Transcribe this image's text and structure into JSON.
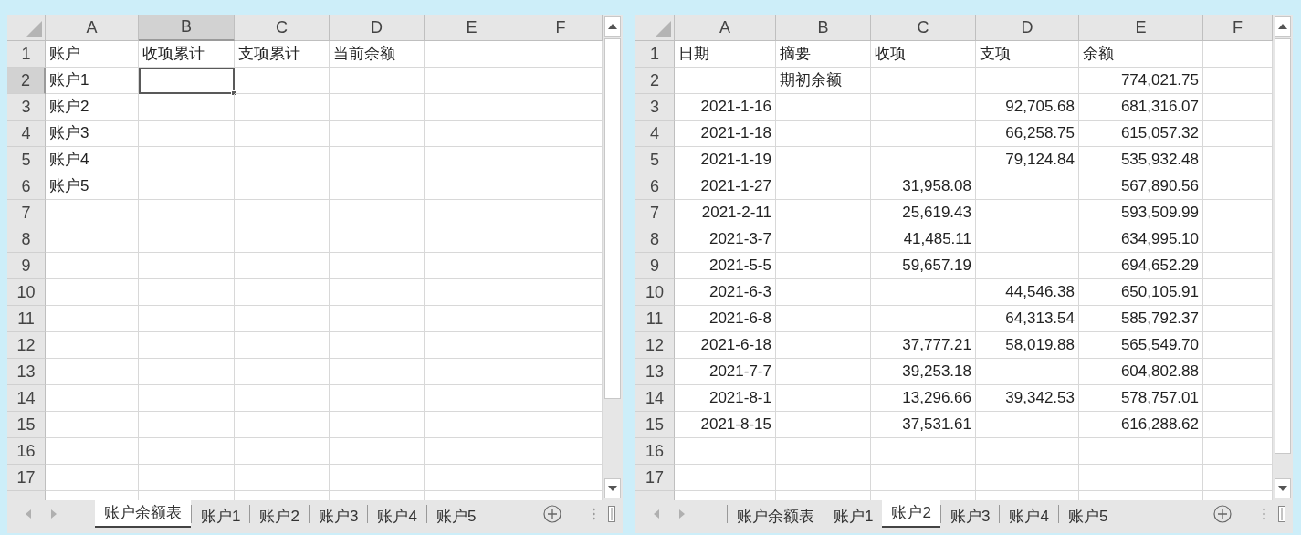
{
  "windows": [
    {
      "columns": [
        {
          "label": "A",
          "selected": false
        },
        {
          "label": "B",
          "selected": true
        },
        {
          "label": "C",
          "selected": false
        },
        {
          "label": "D",
          "selected": false
        },
        {
          "label": "E",
          "selected": false
        },
        {
          "label": "F",
          "selected": false
        }
      ],
      "rows": [
        {
          "num": "1",
          "selected": false,
          "cells": {
            "A": "账户",
            "B": "收项累计",
            "C": "支项累计",
            "D": "当前余额"
          }
        },
        {
          "num": "2",
          "selected": true,
          "cells": {
            "A": "账户1"
          }
        },
        {
          "num": "3",
          "selected": false,
          "cells": {
            "A": "账户2"
          }
        },
        {
          "num": "4",
          "selected": false,
          "cells": {
            "A": "账户3"
          }
        },
        {
          "num": "5",
          "selected": false,
          "cells": {
            "A": "账户4"
          }
        },
        {
          "num": "6",
          "selected": false,
          "cells": {
            "A": "账户5"
          }
        },
        {
          "num": "7",
          "selected": false,
          "cells": {}
        },
        {
          "num": "8",
          "selected": false,
          "cells": {}
        },
        {
          "num": "9",
          "selected": false,
          "cells": {}
        },
        {
          "num": "10",
          "selected": false,
          "cells": {}
        },
        {
          "num": "11",
          "selected": false,
          "cells": {}
        },
        {
          "num": "12",
          "selected": false,
          "cells": {}
        },
        {
          "num": "13",
          "selected": false,
          "cells": {}
        },
        {
          "num": "14",
          "selected": false,
          "cells": {}
        },
        {
          "num": "15",
          "selected": false,
          "cells": {}
        },
        {
          "num": "16",
          "selected": false,
          "cells": {}
        },
        {
          "num": "17",
          "selected": false,
          "cells": {}
        }
      ],
      "tabs": [
        {
          "label": "账户余额表",
          "selected": true
        },
        {
          "label": "账户1",
          "selected": false
        },
        {
          "label": "账户2",
          "selected": false
        },
        {
          "label": "账户3",
          "selected": false
        },
        {
          "label": "账户4",
          "selected": false
        },
        {
          "label": "账户5",
          "selected": false
        }
      ]
    },
    {
      "columns": [
        {
          "label": "A",
          "selected": false
        },
        {
          "label": "B",
          "selected": false
        },
        {
          "label": "C",
          "selected": false
        },
        {
          "label": "D",
          "selected": false
        },
        {
          "label": "E",
          "selected": false
        },
        {
          "label": "F",
          "selected": false
        }
      ],
      "rows": [
        {
          "num": "1",
          "selected": false,
          "cells": {
            "A": "日期",
            "B": "摘要",
            "C": "收项",
            "D": "支项",
            "E": "余额"
          }
        },
        {
          "num": "2",
          "selected": false,
          "cells": {
            "B": "期初余额",
            "E": "774,021.75"
          }
        },
        {
          "num": "3",
          "selected": false,
          "cells": {
            "A": "2021-1-16",
            "D": "92,705.68",
            "E": "681,316.07"
          }
        },
        {
          "num": "4",
          "selected": false,
          "cells": {
            "A": "2021-1-18",
            "D": "66,258.75",
            "E": "615,057.32"
          }
        },
        {
          "num": "5",
          "selected": false,
          "cells": {
            "A": "2021-1-19",
            "D": "79,124.84",
            "E": "535,932.48"
          }
        },
        {
          "num": "6",
          "selected": false,
          "cells": {
            "A": "2021-1-27",
            "C": "31,958.08",
            "E": "567,890.56"
          }
        },
        {
          "num": "7",
          "selected": false,
          "cells": {
            "A": "2021-2-11",
            "C": "25,619.43",
            "E": "593,509.99"
          }
        },
        {
          "num": "8",
          "selected": false,
          "cells": {
            "A": "2021-3-7",
            "C": "41,485.11",
            "E": "634,995.10"
          }
        },
        {
          "num": "9",
          "selected": false,
          "cells": {
            "A": "2021-5-5",
            "C": "59,657.19",
            "E": "694,652.29"
          }
        },
        {
          "num": "10",
          "selected": false,
          "cells": {
            "A": "2021-6-3",
            "D": "44,546.38",
            "E": "650,105.91"
          }
        },
        {
          "num": "11",
          "selected": false,
          "cells": {
            "A": "2021-6-8",
            "D": "64,313.54",
            "E": "585,792.37"
          }
        },
        {
          "num": "12",
          "selected": false,
          "cells": {
            "A": "2021-6-18",
            "C": "37,777.21",
            "D": "58,019.88",
            "E": "565,549.70"
          }
        },
        {
          "num": "13",
          "selected": false,
          "cells": {
            "A": "2021-7-7",
            "C": "39,253.18",
            "E": "604,802.88"
          }
        },
        {
          "num": "14",
          "selected": false,
          "cells": {
            "A": "2021-8-1",
            "C": "13,296.66",
            "D": "39,342.53",
            "E": "578,757.01"
          }
        },
        {
          "num": "15",
          "selected": false,
          "cells": {
            "A": "2021-8-15",
            "C": "37,531.61",
            "E": "616,288.62"
          }
        },
        {
          "num": "16",
          "selected": false,
          "cells": {}
        },
        {
          "num": "17",
          "selected": false,
          "cells": {}
        }
      ],
      "tabs": [
        {
          "label": "账户余额表",
          "selected": false
        },
        {
          "label": "账户1",
          "selected": false
        },
        {
          "label": "账户2",
          "selected": true
        },
        {
          "label": "账户3",
          "selected": false
        },
        {
          "label": "账户4",
          "selected": false
        },
        {
          "label": "账户5",
          "selected": false
        }
      ]
    }
  ]
}
